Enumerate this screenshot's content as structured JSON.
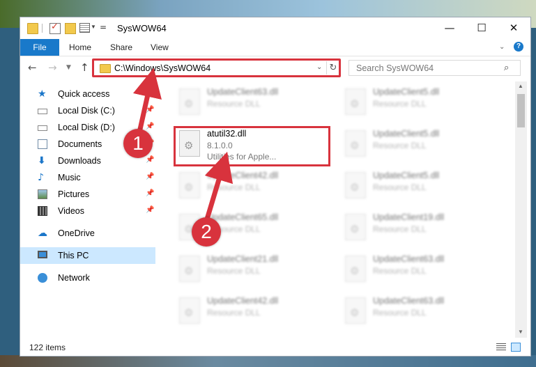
{
  "window": {
    "title": "SysWOW64",
    "controls": {
      "minimize": "—",
      "maximize": "☐",
      "close": "✕"
    }
  },
  "ribbon": {
    "tabs": [
      {
        "label": "File",
        "active": true
      },
      {
        "label": "Home"
      },
      {
        "label": "Share"
      },
      {
        "label": "View"
      }
    ],
    "help_glyph": "?"
  },
  "navigation": {
    "address_path": "C:\\Windows\\SysWOW64",
    "search_placeholder": "Search SysWOW64"
  },
  "sidebar": {
    "items": [
      {
        "label": "Quick access",
        "icon": "star-icon"
      },
      {
        "label": "Local Disk (C:)",
        "icon": "drive-icon",
        "pinned": true
      },
      {
        "label": "Local Disk (D:)",
        "icon": "drive-icon",
        "pinned": true
      },
      {
        "label": "Documents",
        "icon": "documents-icon",
        "pinned": true
      },
      {
        "label": "Downloads",
        "icon": "download-icon",
        "pinned": true
      },
      {
        "label": "Music",
        "icon": "music-icon",
        "pinned": true
      },
      {
        "label": "Pictures",
        "icon": "pictures-icon",
        "pinned": true
      },
      {
        "label": "Videos",
        "icon": "videos-icon",
        "pinned": true
      },
      {
        "label": "OneDrive",
        "icon": "cloud-icon"
      },
      {
        "label": "This PC",
        "icon": "computer-icon",
        "selected": true
      },
      {
        "label": "Network",
        "icon": "network-icon"
      }
    ]
  },
  "files": {
    "left_column": [
      {
        "name": "UpdateClient63.dll",
        "line1": "Resource DLL",
        "blurred": true
      },
      {
        "name": "atutil32.dll",
        "line1": "8.1.0.0",
        "line2": "Utilities for Apple...",
        "highlighted": true
      },
      {
        "name": "UpdateClient42.dll",
        "line1": "Resource DLL",
        "blurred": true
      },
      {
        "name": "UpdateClient65.dll",
        "line1": "Resource DLL",
        "blurred": true
      },
      {
        "name": "UpdateClient21.dll",
        "line1": "Resource DLL",
        "blurred": true
      },
      {
        "name": "UpdateClient42.dll",
        "line1": "Resource DLL",
        "blurred": true
      }
    ],
    "right_column": [
      {
        "name": "UpdateClient5.dll",
        "line1": "Resource DLL",
        "blurred": true
      },
      {
        "name": "UpdateClient5.dll",
        "line1": "Resource DLL",
        "blurred": true
      },
      {
        "name": "UpdateClient5.dll",
        "line1": "Resource DLL",
        "blurred": true
      },
      {
        "name": "UpdateClient19.dll",
        "line1": "Resource DLL",
        "blurred": true
      },
      {
        "name": "UpdateClient63.dll",
        "line1": "Resource DLL",
        "blurred": true
      },
      {
        "name": "UpdateClient63.dll",
        "line1": "Resource DLL",
        "blurred": true
      }
    ]
  },
  "status": {
    "item_count": "122 items"
  },
  "annotations": {
    "marker_1": "1",
    "marker_2": "2",
    "color": "#d8333d"
  }
}
